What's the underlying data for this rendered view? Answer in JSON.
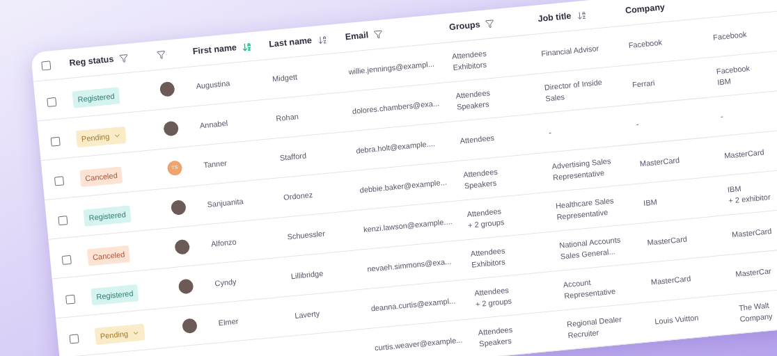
{
  "header_checkbox": {
    "checked": false
  },
  "columns": [
    {
      "label": "Reg status"
    },
    {},
    {
      "label": "First name",
      "active": true
    },
    {
      "label": "Last name",
      "active": false
    },
    {
      "label": "Email"
    },
    {
      "label": "Groups"
    },
    {
      "label": "Job title",
      "active": false
    },
    {
      "label": "Company"
    },
    {}
  ],
  "rows": [
    {
      "checked": false,
      "status": {
        "label": "Registered",
        "kind": "registered",
        "dropdown": false
      },
      "avatar": {
        "kind": "photo"
      },
      "first_name": "Augustina",
      "last_name": "Midgett",
      "email": "willie.jennings@exampl...",
      "groups": [
        "Attendees",
        "Exhibitors"
      ],
      "job_title": [
        "Financial Advisor"
      ],
      "company": [
        "Facebook"
      ],
      "column_8": [
        "Facebook"
      ]
    },
    {
      "checked": false,
      "status": {
        "label": "Pending",
        "kind": "pending",
        "dropdown": true
      },
      "avatar": {
        "kind": "photo"
      },
      "first_name": "Annabel",
      "last_name": "Rohan",
      "email": "dolores.chambers@exa...",
      "groups": [
        "Attendees",
        "Speakers"
      ],
      "job_title": [
        "Director of Inside",
        "Sales"
      ],
      "company": [
        "Ferrari"
      ],
      "column_8": [
        "Facebook",
        "IBM"
      ]
    },
    {
      "checked": false,
      "status": {
        "label": "Canceled",
        "kind": "canceled",
        "dropdown": false
      },
      "avatar": {
        "kind": "initials",
        "text": "TS"
      },
      "first_name": "Tanner",
      "last_name": "Stafford",
      "email": "debra.holt@example....",
      "groups": [
        "Attendees"
      ],
      "job_title": [
        "-"
      ],
      "company": [
        "-"
      ],
      "column_8": [
        "-"
      ]
    },
    {
      "checked": false,
      "status": {
        "label": "Registered",
        "kind": "registered",
        "dropdown": false
      },
      "avatar": {
        "kind": "photo"
      },
      "first_name": "Sanjuanita",
      "last_name": "Ordonez",
      "email": "debbie.baker@example...",
      "groups": [
        "Attendees",
        "Speakers"
      ],
      "job_title": [
        "Advertising Sales",
        "Representative"
      ],
      "company": [
        "MasterCard"
      ],
      "column_8": [
        "MasterCard"
      ]
    },
    {
      "checked": false,
      "status": {
        "label": "Canceled",
        "kind": "canceled",
        "dropdown": false
      },
      "avatar": {
        "kind": "photo"
      },
      "first_name": "Alfonzo",
      "last_name": "Schuessler",
      "email": "kenzi.lawson@example....",
      "groups": [
        "Attendees",
        "+ 2 groups"
      ],
      "job_title": [
        "Healthcare Sales",
        "Representative"
      ],
      "company": [
        "IBM"
      ],
      "column_8": [
        "IBM",
        "+ 2 exhibitor"
      ]
    },
    {
      "checked": false,
      "status": {
        "label": "Registered",
        "kind": "registered",
        "dropdown": false
      },
      "avatar": {
        "kind": "photo"
      },
      "first_name": "Cyndy",
      "last_name": "Lillibridge",
      "email": "nevaeh.simmons@exa...",
      "groups": [
        "Attendees",
        "Exhibitors"
      ],
      "job_title": [
        "National Accounts",
        "Sales General..."
      ],
      "company": [
        "MasterCard"
      ],
      "column_8": [
        "MasterCard"
      ]
    },
    {
      "checked": false,
      "status": {
        "label": "Pending",
        "kind": "pending",
        "dropdown": true
      },
      "avatar": {
        "kind": "photo"
      },
      "first_name": "Elmer",
      "last_name": "Laverty",
      "email": "deanna.curtis@exampl...",
      "groups": [
        "Attendees",
        "+ 2 groups"
      ],
      "job_title": [
        "Account",
        "Representative"
      ],
      "company": [
        "MasterCard"
      ],
      "column_8": [
        "MasterCar"
      ]
    },
    {
      "email": "curtis.weaver@example...",
      "groups": [
        "Attendees",
        "Speakers"
      ],
      "job_title": [
        "Regional Dealer",
        "Recruiter"
      ],
      "company": [
        "Louis Vuitton"
      ],
      "column_8": [
        "The Walt",
        "Company"
      ]
    }
  ]
}
